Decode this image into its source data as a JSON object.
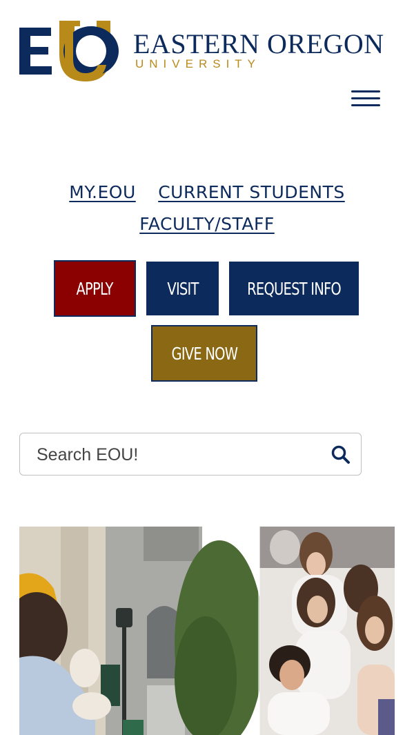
{
  "header": {
    "logo_letters": "EOU",
    "wordmark_line1": "EASTERN OREGON",
    "wordmark_line2": "UNIVERSITY",
    "menu_icon": "hamburger-menu-icon"
  },
  "utility_links": [
    {
      "label": "MY.EOU"
    },
    {
      "label": "CURRENT STUDENTS"
    },
    {
      "label": "FACULTY/STAFF"
    }
  ],
  "cta_buttons": {
    "apply": "APPLY",
    "visit": "VISIT",
    "request_info": "REQUEST INFO",
    "give_now": "GIVE NOW"
  },
  "search": {
    "placeholder": "Search EOU!",
    "value": "",
    "icon": "search-icon"
  },
  "colors": {
    "navy": "#0c2a5b",
    "gold": "#b88a1a",
    "apply_red": "#8b0000",
    "give_gold": "#8b6914"
  },
  "hero_photo": {
    "icon": "campus-photo"
  }
}
